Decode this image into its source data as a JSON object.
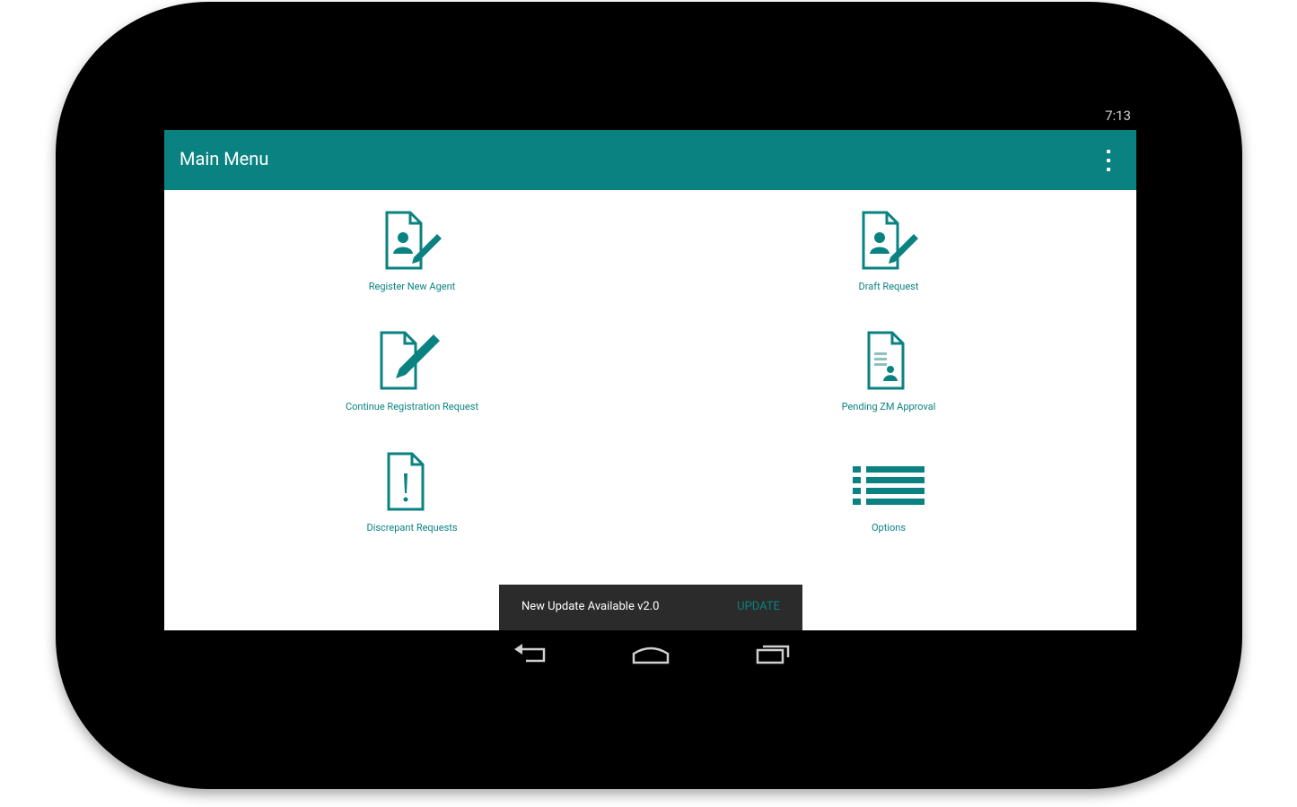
{
  "status_bar": {
    "time": "7:13"
  },
  "app_bar": {
    "title": "Main Menu",
    "overflow_icon": "more-vert-icon"
  },
  "menu": {
    "items": [
      {
        "label": "Register New Agent",
        "icon": "register-agent-icon"
      },
      {
        "label": "Draft Request",
        "icon": "draft-request-icon"
      },
      {
        "label": "Continue Registration Request",
        "icon": "edit-document-icon"
      },
      {
        "label": "Pending ZM Approval",
        "icon": "pending-approval-icon"
      },
      {
        "label": "Discrepant Requests",
        "icon": "discrepant-document-icon"
      },
      {
        "label": "Options",
        "icon": "list-icon"
      }
    ]
  },
  "snackbar": {
    "message": "New Update Available v2.0",
    "action": "UPDATE"
  },
  "nav_bar": {
    "buttons": [
      "back-icon",
      "home-icon",
      "recents-icon"
    ]
  },
  "colors": {
    "primary": "#0a8281",
    "snackbar": "#2b2b2b"
  }
}
